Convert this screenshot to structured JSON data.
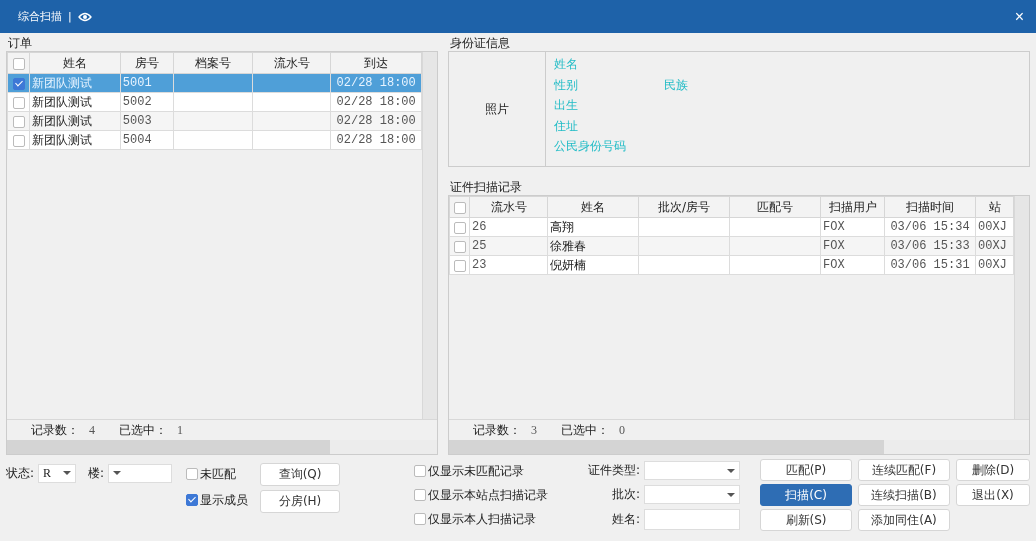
{
  "window": {
    "title": "综合扫描",
    "separator": "|",
    "close": "×"
  },
  "orders": {
    "title": "订单",
    "header_checked": false,
    "columns": [
      "姓名",
      "房号",
      "档案号",
      "流水号",
      "到达"
    ],
    "rows": [
      {
        "checked": true,
        "selected": true,
        "name": "新团队测试",
        "room": "5001",
        "arrival": "02/28 18:00"
      },
      {
        "checked": false,
        "selected": false,
        "name": "新团队测试",
        "room": "5002",
        "arrival": "02/28 18:00"
      },
      {
        "checked": false,
        "selected": false,
        "name": "新团队测试",
        "room": "5003",
        "arrival": "02/28 18:00"
      },
      {
        "checked": false,
        "selected": false,
        "name": "新团队测试",
        "room": "5004",
        "arrival": "02/28 18:00"
      }
    ],
    "footer": {
      "count_label": "记录数：",
      "count": "4",
      "selected_label": "已选中：",
      "selected_count": "1"
    }
  },
  "order_filters": {
    "status_label": "状态:",
    "status_value": "R",
    "building_label": "楼:",
    "checkboxes": [
      {
        "label": "未匹配",
        "checked": false
      },
      {
        "label": "显示成员",
        "checked": true
      }
    ],
    "buttons": [
      "查询(Q)",
      "分房(H)"
    ]
  },
  "id_info": {
    "title": "身份证信息",
    "photo": "照片",
    "fields": [
      "姓名",
      "性别",
      "民族",
      "出生",
      "住址",
      "公民身份号码"
    ]
  },
  "scan_records": {
    "title": "证件扫描记录",
    "header_checked": false,
    "columns": [
      "流水号",
      "姓名",
      "批次/房号",
      "匹配号",
      "扫描用户",
      "扫描时间",
      "站"
    ],
    "rows": [
      {
        "checked": false,
        "serial": "26",
        "name": "高翔",
        "user": "FOX",
        "time": "03/06 15:34",
        "site": "00XJ"
      },
      {
        "checked": false,
        "serial": "25",
        "name": "徐雅春",
        "user": "FOX",
        "time": "03/06 15:33",
        "site": "00XJ"
      },
      {
        "checked": false,
        "serial": "23",
        "name": "倪妍楠",
        "user": "FOX",
        "time": "03/06 15:31",
        "site": "00XJ"
      }
    ],
    "footer": {
      "count_label": "记录数：",
      "count": "3",
      "selected_label": "已选中：",
      "selected_count": "0"
    }
  },
  "scan_filters": {
    "checkboxes": [
      {
        "label": "仅显示未匹配记录",
        "checked": false
      },
      {
        "label": "仅显示本站点扫描记录",
        "checked": false
      },
      {
        "label": "仅显示本人扫描记录",
        "checked": false
      }
    ],
    "fields": [
      {
        "kind": "dropdown",
        "label": "证件类型:"
      },
      {
        "kind": "dropdown",
        "label": "批次:"
      },
      {
        "kind": "text",
        "label": "姓名:"
      }
    ],
    "buttons": [
      {
        "label": "匹配(P)",
        "primary": false
      },
      {
        "label": "连续匹配(F)",
        "primary": false
      },
      {
        "label": "删除(D)",
        "primary": false
      },
      {
        "label": "扫描(C)",
        "primary": true
      },
      {
        "label": "连续扫描(B)",
        "primary": false
      },
      {
        "label": "退出(X)",
        "primary": false
      },
      {
        "label": "刷新(S)",
        "primary": false
      },
      {
        "label": "添加同住(A)",
        "primary": false
      }
    ]
  }
}
